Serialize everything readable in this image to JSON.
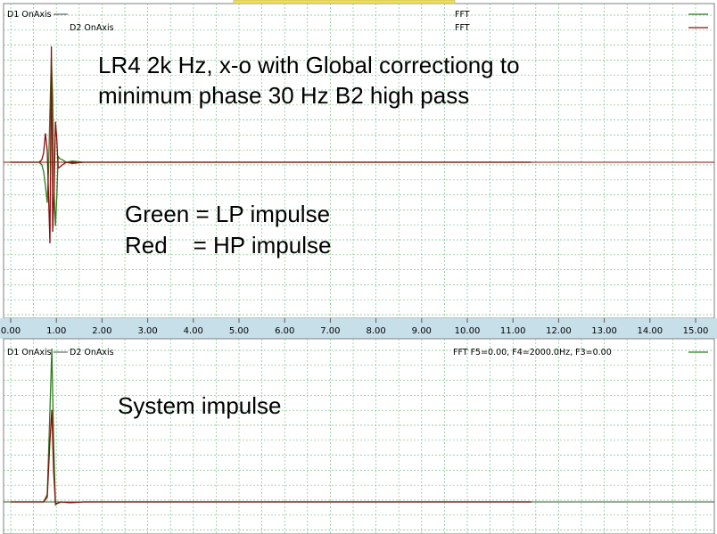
{
  "colors": {
    "grid": "#7fbf8a",
    "axis_band": "#c7dfe9",
    "trace_green": "#2e7d1d",
    "trace_red": "#8b0d0d",
    "baseline": "#2d5a2d"
  },
  "top_panel": {
    "legend": {
      "d1": "D1 OnAxis",
      "d2": "D2 OnAxis",
      "fft1": "FFT",
      "fft2": "FFT"
    },
    "annotation": {
      "line1": "LR4 2k Hz, x-o with Global correctiong to",
      "line2": "minimum phase 30 Hz B2 high pass",
      "line3": "Green = LP impulse",
      "line4": "Red    = HP impulse"
    }
  },
  "bottom_panel": {
    "legend": {
      "d1": "D1 OnAxis",
      "d2": "D2 OnAxis",
      "fft": "FFT  F5=0.00, F4=2000.0Hz, F3=0.00"
    },
    "annotation": {
      "line1": "System impulse"
    }
  },
  "chart_data": [
    {
      "type": "line",
      "x_tick_labels": [
        "0.00",
        "1.00",
        "2.00",
        "3.00",
        "4.00",
        "5.00",
        "6.00",
        "7.00",
        "8.00",
        "9.00",
        "10.00",
        "11.00",
        "12.00",
        "13.00",
        "14.00",
        "15.00"
      ],
      "xlim": [
        0,
        15.5
      ],
      "ylim": [
        -1,
        1
      ],
      "grid": true,
      "series": [
        {
          "color": "#2e7d1d",
          "x": [
            0,
            0.62,
            0.68,
            0.72,
            0.76,
            0.8,
            0.83,
            0.86,
            0.89,
            0.92,
            0.95,
            0.98,
            1.01,
            1.04,
            1.08,
            1.14,
            1.22,
            1.35,
            1.6,
            2.0,
            4,
            6,
            8,
            10,
            11.4
          ],
          "y": [
            0,
            0,
            -0.02,
            -0.08,
            -0.2,
            -0.35,
            -0.05,
            0.45,
            0.9,
            0.55,
            -0.25,
            -0.55,
            -0.3,
            0.05,
            0.03,
            0.02,
            0.0,
            0.01,
            0.0,
            0.0,
            0,
            0,
            0,
            0,
            0
          ]
        },
        {
          "color": "#8b0d0d",
          "x": [
            0,
            0.62,
            0.68,
            0.72,
            0.76,
            0.8,
            0.83,
            0.86,
            0.89,
            0.92,
            0.95,
            0.98,
            1.01,
            1.04,
            1.08,
            1.14,
            1.22,
            1.35,
            1.6,
            2.0,
            4,
            6,
            8,
            10,
            11.4
          ],
          "y": [
            0,
            0,
            0.02,
            0.08,
            0.25,
            0.1,
            -0.3,
            -0.7,
            1.0,
            -0.6,
            -0.25,
            0.35,
            0.2,
            -0.05,
            -0.04,
            -0.02,
            0.0,
            -0.01,
            0.0,
            0.0,
            0,
            0,
            0,
            0,
            0
          ]
        }
      ]
    },
    {
      "type": "line",
      "x_tick_labels": [],
      "xlim": [
        0,
        15.5
      ],
      "ylim": [
        -0.1,
        1
      ],
      "grid": true,
      "series": [
        {
          "color": "#2e7d1d",
          "x": [
            0,
            0.72,
            0.8,
            0.86,
            0.9,
            0.94,
            0.98,
            1.02,
            1.1,
            1.3,
            1.6,
            2,
            4,
            6,
            8,
            10,
            11.4
          ],
          "y": [
            0,
            0,
            0.05,
            0.6,
            1.0,
            0.4,
            -0.02,
            -0.01,
            0.0,
            -0.005,
            0.0,
            0,
            0,
            0,
            0,
            0,
            0
          ]
        },
        {
          "color": "#8b0d0d",
          "x": [
            0,
            0.72,
            0.8,
            0.86,
            0.9,
            0.94,
            0.98,
            1.02,
            1.1,
            1.3,
            1.6,
            2,
            4,
            6,
            8,
            10,
            11.4
          ],
          "y": [
            0,
            0,
            0.03,
            0.4,
            0.6,
            0.2,
            -0.01,
            -0.01,
            0.0,
            -0.005,
            0.0,
            0,
            0,
            0,
            0,
            0,
            0
          ]
        }
      ]
    }
  ]
}
